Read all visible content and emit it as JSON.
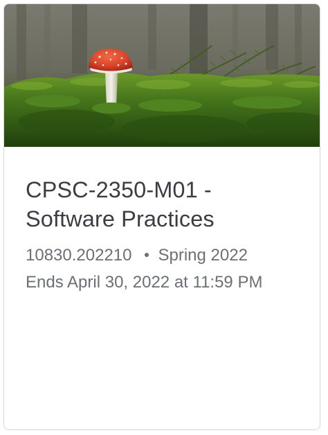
{
  "course_card": {
    "title": "CPSC-2350-M01 - Software Practices",
    "section_code": "10830.202210",
    "term": "Spring 2022",
    "end_date": "Ends April 30, 2022 at 11:59 PM"
  },
  "hero_image": {
    "subject": "red-mushroom-in-moss",
    "colors": {
      "cap": "#d8432a",
      "moss": "#3f6d1c",
      "forest": "#5a5a4c"
    }
  }
}
